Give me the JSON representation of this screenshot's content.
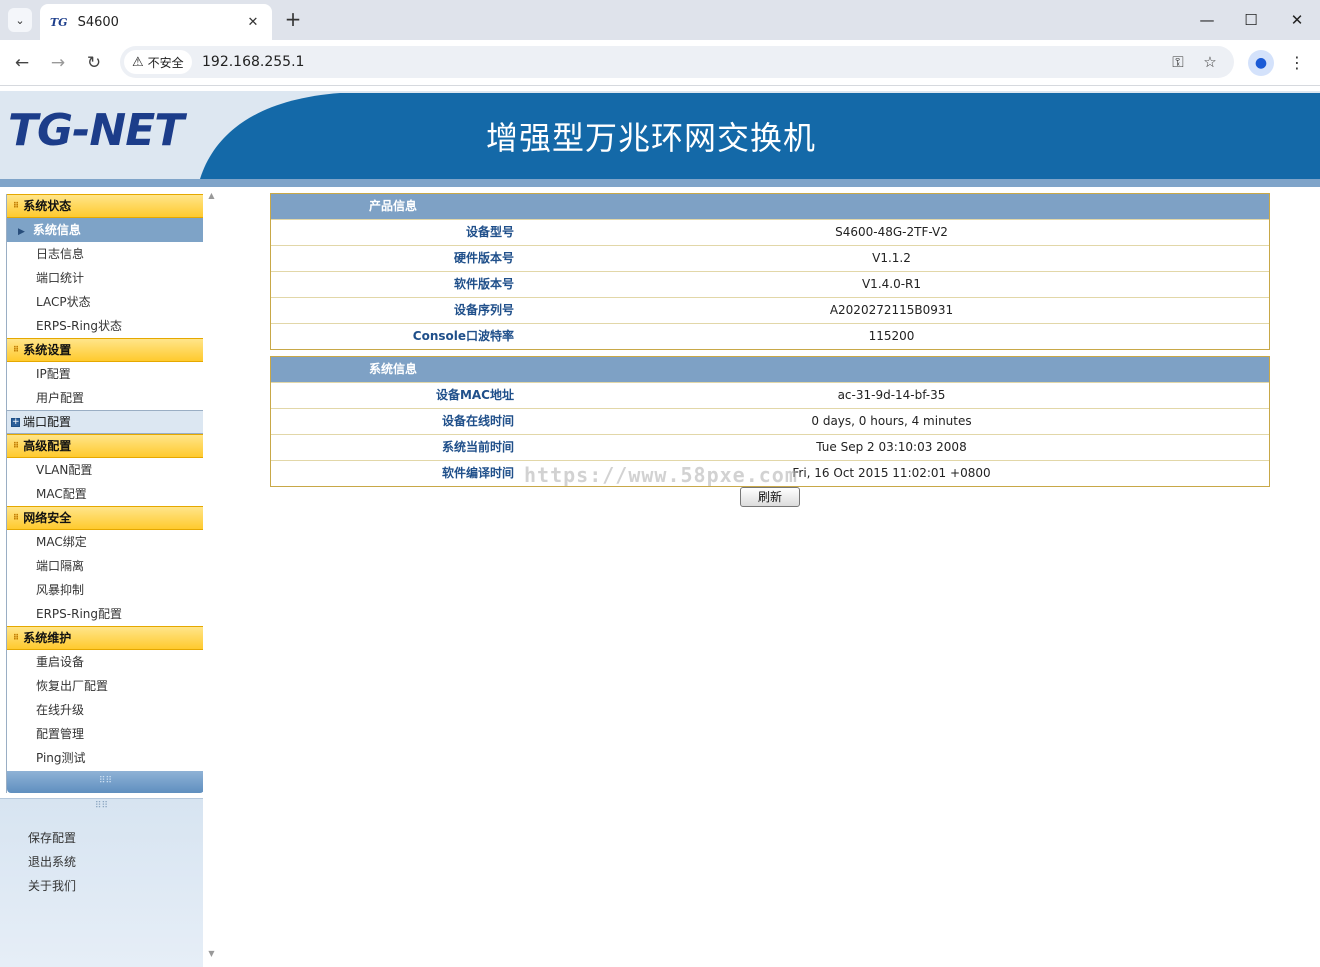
{
  "browser": {
    "tab_title": "S4600",
    "tab_favicon": "TG",
    "security_label": "不安全",
    "url": "192.168.255.1",
    "icons": [
      "tab-list-icon",
      "close-icon",
      "plus-icon",
      "minimize-icon",
      "maximize-icon",
      "window-close-icon",
      "back-icon",
      "forward-icon",
      "reload-icon",
      "warning-icon",
      "key-icon",
      "star-icon",
      "profile-icon",
      "more-icon"
    ]
  },
  "header": {
    "logo": "TG-NET",
    "title": "增强型万兆环网交换机"
  },
  "menu": {
    "groups": [
      {
        "label": "系统状态",
        "items": [
          "系统信息",
          "日志信息",
          "端口统计",
          "LACP状态",
          "ERPS-Ring状态"
        ]
      },
      {
        "label": "系统设置",
        "items": [
          "IP配置",
          "用户配置"
        ]
      },
      {
        "label": "端口配置",
        "items": []
      },
      {
        "label": "高级配置",
        "items": [
          "VLAN配置",
          "MAC配置"
        ]
      },
      {
        "label": "网络安全",
        "items": [
          "MAC绑定",
          "端口隔离",
          "风暴抑制",
          "ERPS-Ring配置"
        ]
      },
      {
        "label": "系统维护",
        "items": [
          "重启设备",
          "恢复出厂配置",
          "在线升级",
          "配置管理",
          "Ping测试"
        ]
      }
    ],
    "active_item": "系统信息",
    "bottom_links": [
      "保存配置",
      "退出系统",
      "关于我们"
    ]
  },
  "product_info": {
    "title": "产品信息",
    "rows": [
      {
        "label": "设备型号",
        "value": "S4600-48G-2TF-V2"
      },
      {
        "label": "硬件版本号",
        "value": "V1.1.2"
      },
      {
        "label": "软件版本号",
        "value": "V1.4.0-R1"
      },
      {
        "label": "设备序列号",
        "value": "A2020272115B0931"
      },
      {
        "label": "Console口波特率",
        "value": "115200"
      }
    ]
  },
  "system_info": {
    "title": "系统信息",
    "rows": [
      {
        "label": "设备MAC地址",
        "value": "ac-31-9d-14-bf-35"
      },
      {
        "label": "设备在线时间",
        "value": "0 days, 0 hours, 4 minutes"
      },
      {
        "label": "系统当前时间",
        "value": "Tue Sep 2 03:10:03 2008"
      },
      {
        "label": "软件编译时间",
        "value": "Fri, 16 Oct 2015 11:02:01 +0800"
      }
    ]
  },
  "watermark": "https://www.58pxe.com",
  "refresh_label": "刷新",
  "colors": {
    "banner_blue": "#1469a8",
    "menu_group": "#ffca2e",
    "panel_head": "#7ea1c5",
    "label_text": "#1f4f8a"
  }
}
